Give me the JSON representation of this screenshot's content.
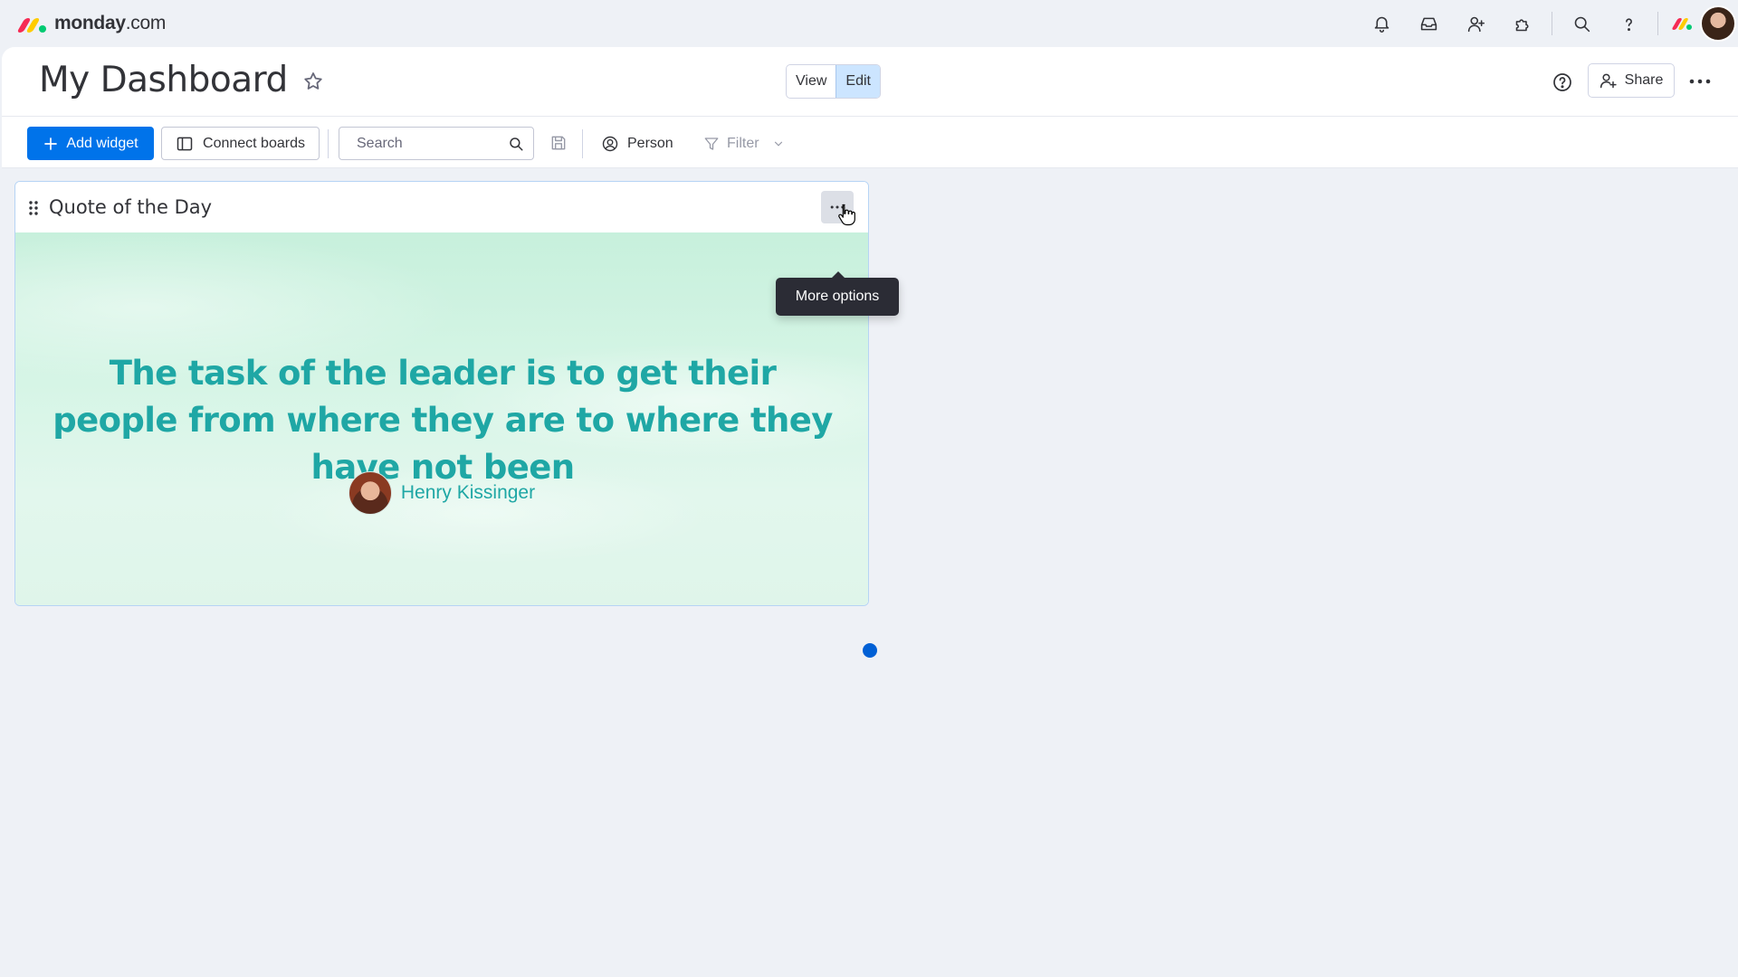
{
  "brand": {
    "name_bold": "monday",
    "name_suffix": ".com"
  },
  "topbar": {
    "icons": [
      "bell-icon",
      "inbox-icon",
      "invite-members-icon",
      "apps-icon",
      "search-icon",
      "help-icon"
    ]
  },
  "header": {
    "title": "My Dashboard",
    "view_label": "View",
    "edit_label": "Edit",
    "share_label": "Share"
  },
  "toolbar": {
    "add_widget_label": "Add widget",
    "connect_boards_label": "Connect boards",
    "search_placeholder": "Search",
    "person_label": "Person",
    "filter_label": "Filter"
  },
  "widget": {
    "title": "Quote of the Day",
    "tooltip": "More options",
    "quote": "The task of the leader is to get their people from where they are to where they have not been",
    "author": "Henry Kissinger"
  },
  "colors": {
    "primary": "#0073ea",
    "quote_teal": "#1fa7a5",
    "edit_active": "#cce5ff"
  }
}
